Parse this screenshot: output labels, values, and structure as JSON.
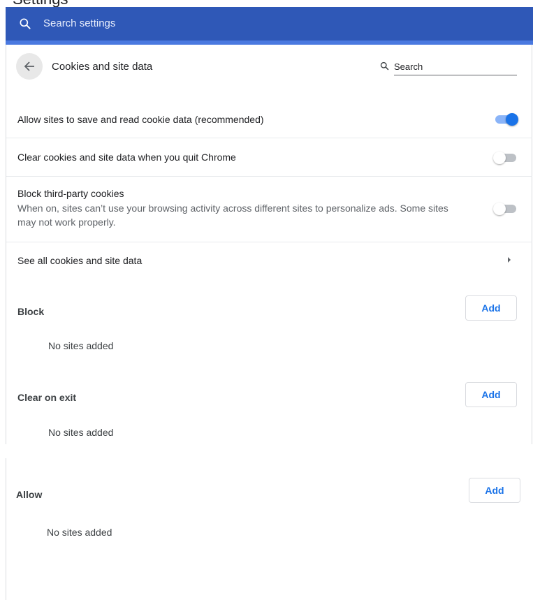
{
  "window": {
    "partial_title": "Settings"
  },
  "topbar": {
    "icon": "search-icon",
    "search_placeholder": "Search settings"
  },
  "header": {
    "back_icon": "arrow-left-icon",
    "title": "Cookies and site data",
    "search_icon": "search-icon",
    "search_placeholder": "Search"
  },
  "settings": [
    {
      "label": "Allow sites to save and read cookie data (recommended)",
      "enabled": true
    },
    {
      "label": "Clear cookies and site data when you quit Chrome",
      "enabled": false
    },
    {
      "label": "Block third-party cookies",
      "description": "When on, sites can’t use your browsing activity across different sites to personalize ads. Some sites may not work properly.",
      "enabled": false
    },
    {
      "label": "See all cookies and site data",
      "icon": "chevron-right-icon"
    }
  ],
  "sections": [
    {
      "label": "Block",
      "button": "Add",
      "empty": "No sites added"
    },
    {
      "label": "Clear on exit",
      "button": "Add",
      "empty": "No sites added"
    },
    {
      "label": "Allow",
      "button": "Add",
      "empty": "No sites added"
    }
  ],
  "colors": {
    "topbar": "#2f58b7",
    "accent": "#1a73e8",
    "toggle_track_on": "#8ab4f8"
  }
}
